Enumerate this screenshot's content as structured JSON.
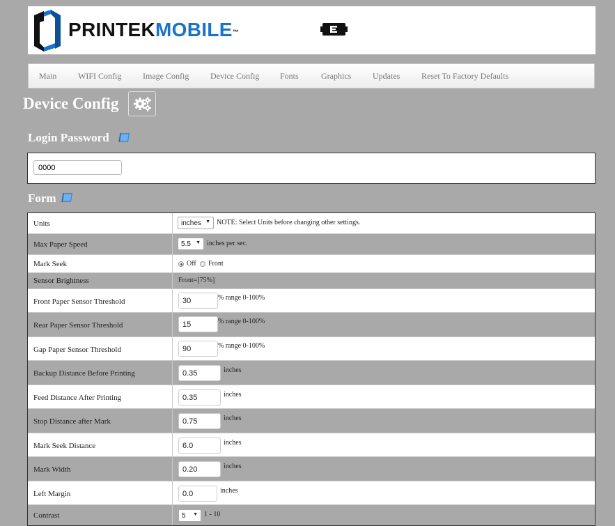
{
  "header": {
    "logo_part1": "PRINTEK",
    "logo_part2": "MOBILE",
    "logo_tm": "™",
    "brand_color": "#1a73c8"
  },
  "nav": {
    "items": [
      "Main",
      "WIFI Config",
      "Image Config",
      "Device Config",
      "Fonts",
      "Graphics",
      "Updates",
      "Reset To Factory Defaults"
    ]
  },
  "page": {
    "title": "Device Config"
  },
  "login": {
    "title": "Login Password",
    "value": "0000"
  },
  "form": {
    "title": "Form",
    "units": {
      "label": "Units",
      "value": "inches",
      "note": "NOTE: Select Units before changing other settings."
    },
    "max_speed": {
      "label": "Max Paper Speed",
      "value": "5.5",
      "note": "inches per sec."
    },
    "mark_seek": {
      "label": "Mark Seek",
      "opt_off": "Off",
      "opt_front": "Front",
      "selected": "Off"
    },
    "sensor_brightness": {
      "label": "Sensor Brightness",
      "value": "Front=[75%]"
    },
    "front_threshold": {
      "label": "Front Paper Sensor Threshold",
      "value": "30",
      "note": "% range 0-100%"
    },
    "rear_threshold": {
      "label": "Rear Paper Sensor Threshold",
      "value": "15",
      "note": "% range 0-100%"
    },
    "gap_threshold": {
      "label": "Gap Paper Sensor Threshold",
      "value": "90",
      "note": "% range 0-100%"
    },
    "backup_distance": {
      "label": "Backup Distance Before Printing",
      "value": "0.35",
      "note": "inches"
    },
    "feed_distance": {
      "label": "Feed Distance After Printing",
      "value": "0.35",
      "note": "inches"
    },
    "stop_distance": {
      "label": "Stop Distance after Mark",
      "value": "0.75",
      "note": "inches"
    },
    "mark_seek_distance": {
      "label": "Mark Seek Distance",
      "value": "6.0",
      "note": "inches"
    },
    "mark_width": {
      "label": "Mark Width",
      "value": "0.20",
      "note": "inches"
    },
    "left_margin": {
      "label": "Left Margin",
      "value": "0.0",
      "note": "inches"
    },
    "contrast": {
      "label": "Contrast",
      "value": "5",
      "note": "1 - 10"
    }
  }
}
